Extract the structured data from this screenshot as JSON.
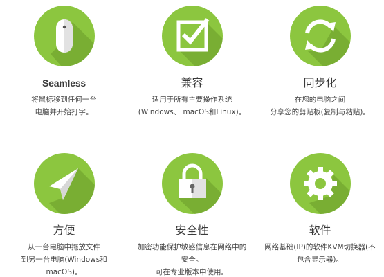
{
  "colors": {
    "green": "#8cc63f",
    "shadow": "#6a9a2a",
    "glyph": "#ffffff",
    "glyph_shade": "#d7d7d7"
  },
  "features": [
    {
      "icon": "mouse-icon",
      "title": "Seamless",
      "desc": [
        "将鼠标移到任何一台",
        "电脑并开始打字。"
      ]
    },
    {
      "icon": "checkbox-icon",
      "title": "兼容",
      "desc": [
        "适用于所有主要操作系统",
        "(Windows、 macOS和Linux)。"
      ]
    },
    {
      "icon": "sync-icon",
      "title": "同步化",
      "desc": [
        "在您的电脑之间",
        "分享您的剪贴板(复制与粘贴)。"
      ]
    },
    {
      "icon": "cursor-arrow-icon",
      "title": "方便",
      "desc": [
        "从一台电脑中拖放文件",
        "到另一台电脑(Windows和",
        "macOS)。"
      ]
    },
    {
      "icon": "padlock-icon",
      "title": "安全性",
      "desc": [
        "加密功能保护敏感信息在网络中的",
        "安全。",
        "可在专业版本中使用。"
      ]
    },
    {
      "icon": "gear-icon",
      "title": "软件",
      "desc": [
        "网络基础(IP)的软件KVM切换器(不",
        "包含显示器)。"
      ]
    }
  ]
}
